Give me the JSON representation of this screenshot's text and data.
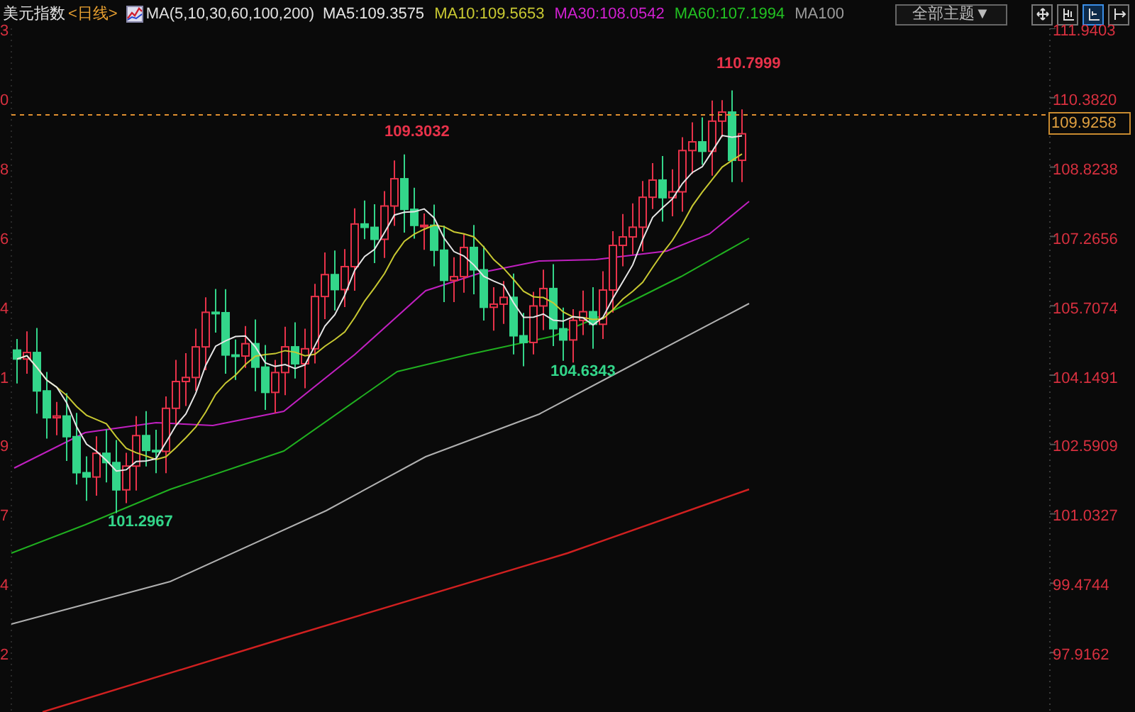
{
  "header": {
    "symbol": "美元指数",
    "period": "<日线>",
    "indicator": "MA(5,10,30,60,100,200)",
    "ma_values": [
      {
        "label": "MA5:109.3575",
        "color": "#e6e6e6"
      },
      {
        "label": "MA10:109.5653",
        "color": "#c8c832"
      },
      {
        "label": "MA30:108.0542",
        "color": "#d020d0"
      },
      {
        "label": "MA60:107.1994",
        "color": "#22c022"
      },
      {
        "label": "MA100",
        "color": "#9a9a9a"
      }
    ]
  },
  "toolbar": {
    "theme_dropdown": "全部主题▼",
    "buttons": [
      {
        "selected": false
      },
      {
        "selected": false
      },
      {
        "selected": true
      },
      {
        "selected": false
      }
    ]
  },
  "left_axis": {
    "labels": [
      "3",
      "0",
      "8",
      "6",
      "4",
      "1",
      "9",
      "7",
      "4",
      "2"
    ]
  },
  "price_axis": {
    "labels": [
      "111.9403",
      "110.3820",
      "108.8238",
      "107.2656",
      "105.7074",
      "104.1491",
      "102.5909",
      "101.0327",
      "99.4744",
      "97.9162"
    ],
    "current_price": "109.9258"
  },
  "annotations": [
    {
      "text": "110.7999",
      "kind": "high"
    },
    {
      "text": "109.3032",
      "kind": "high"
    },
    {
      "text": "104.6343",
      "kind": "low"
    },
    {
      "text": "101.2967",
      "kind": "low"
    }
  ]
}
